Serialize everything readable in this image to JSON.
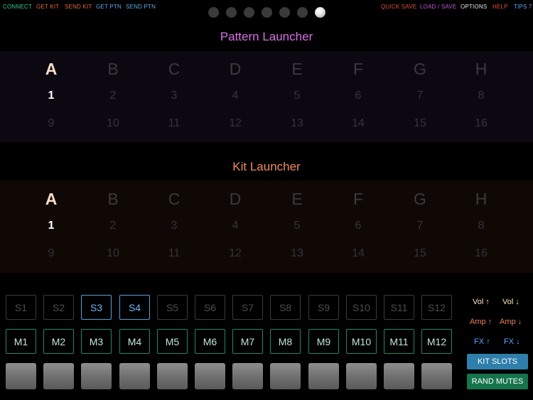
{
  "topbar": {
    "connect": "CONNECT",
    "get_kit": "GET KIT",
    "send_kit": "SEND KIT",
    "get_ptn": "GET PTN",
    "send_ptn": "SEND PTN",
    "quick_save": "QUICK SAVE",
    "load_save": "LOAD / SAVE",
    "options": "OPTIONS",
    "help": "HELP",
    "tips": "TIPS 7"
  },
  "page_dots": {
    "count": 7,
    "active_index": 6
  },
  "pattern_launcher": {
    "title": "Pattern Launcher",
    "banks": [
      "A",
      "B",
      "C",
      "D",
      "E",
      "F",
      "G",
      "H"
    ],
    "row1": [
      "1",
      "2",
      "3",
      "4",
      "5",
      "6",
      "7",
      "8"
    ],
    "row2": [
      "9",
      "10",
      "11",
      "12",
      "13",
      "14",
      "15",
      "16"
    ],
    "active_bank": 0,
    "active_number": 0
  },
  "kit_launcher": {
    "title": "Kit Launcher",
    "banks": [
      "A",
      "B",
      "C",
      "D",
      "E",
      "F",
      "G",
      "H"
    ],
    "row1": [
      "1",
      "2",
      "3",
      "4",
      "5",
      "6",
      "7",
      "8"
    ],
    "row2": [
      "9",
      "10",
      "11",
      "12",
      "13",
      "14",
      "15",
      "16"
    ],
    "active_bank": 0,
    "active_number": 0
  },
  "s_pads": [
    "S1",
    "S2",
    "S3",
    "S4",
    "S5",
    "S6",
    "S7",
    "S8",
    "S9",
    "S10",
    "S11",
    "S12"
  ],
  "s_pads_active": [
    2,
    3
  ],
  "m_pads": [
    "M1",
    "M2",
    "M3",
    "M4",
    "M5",
    "M6",
    "M7",
    "M8",
    "M9",
    "M10",
    "M11",
    "M12"
  ],
  "controls": {
    "vol_up": "Vol ↑",
    "vol_down": "Vol ↓",
    "amp_up": "Amp ↑",
    "amp_down": "Amp ↓",
    "fx_up": "FX ↑",
    "fx_down": "FX ↓",
    "kit_slots": "KIT SLOTS",
    "rand_mutes": "RAND MUTES"
  },
  "colors": {
    "connect": "#2fd08a",
    "get_kit": "#e26a3c",
    "send_kit": "#e26a3c",
    "get_ptn": "#5aa8e8",
    "send_ptn": "#5aa8e8",
    "quick_save": "#e0503a",
    "load_save": "#c457d8",
    "options": "#e6e6e6",
    "help": "#e0503a",
    "tips": "#5aa8e8",
    "pattern_title": "#d96ee8",
    "kit_title": "#ef8a5c",
    "pattern_bg": "#0c0812",
    "kit_bg": "#100805",
    "vol": "#ffe2c0",
    "amp": "#ef7f52",
    "fx": "#5aa8ff",
    "kit_slots_bg": "#2f7fab",
    "rand_mutes_bg": "#16744d"
  }
}
